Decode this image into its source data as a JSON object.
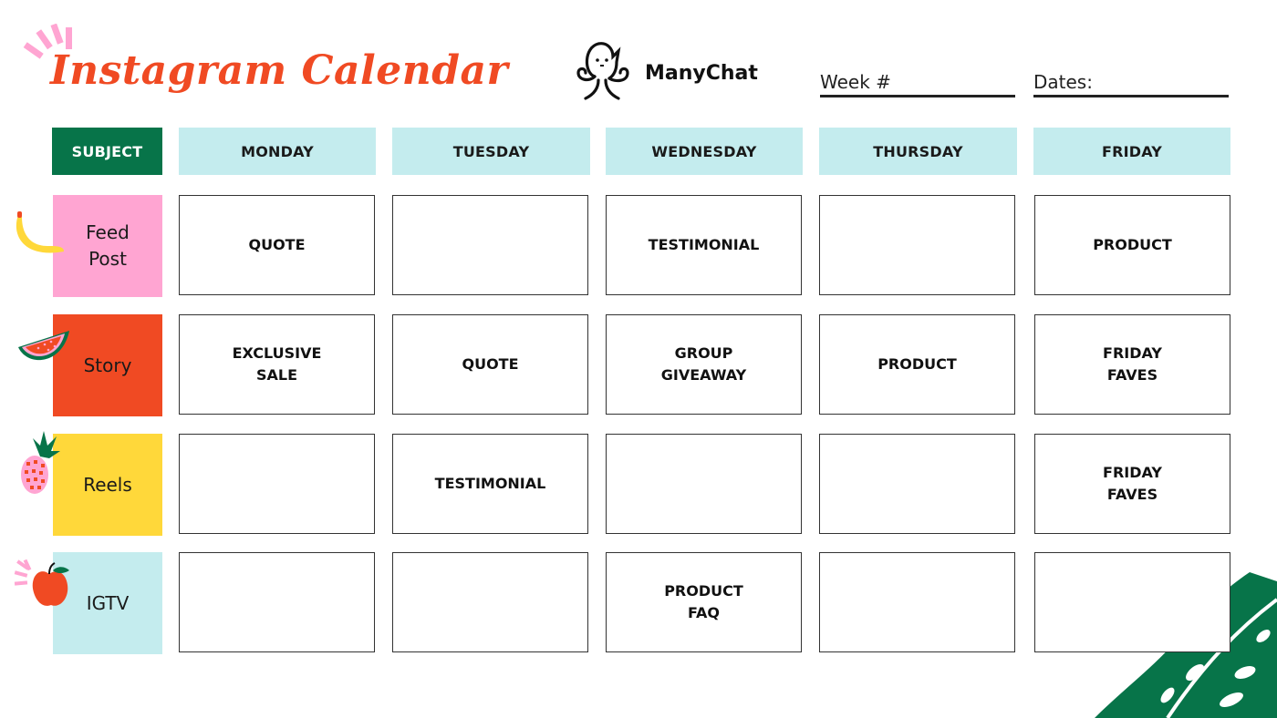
{
  "header": {
    "title": "Instagram Calendar",
    "brand": "ManyChat",
    "week_label": "Week #",
    "week_value": "",
    "dates_label": "Dates:",
    "dates_value": ""
  },
  "colors": {
    "title": "#f04a23",
    "subject_header": "#077449",
    "day_header": "#c4ecee",
    "feed_post": "#ffa5d2",
    "story": "#f04a23",
    "reels": "#ffd83a",
    "igtv": "#c4ecee",
    "leaf": "#077449"
  },
  "columns": {
    "subject": "SUBJECT",
    "days": [
      "MONDAY",
      "TUESDAY",
      "WEDNESDAY",
      "THURSDAY",
      "FRIDAY"
    ]
  },
  "rows": [
    {
      "label": "Feed\nPost",
      "icon": "banana-icon",
      "cells": [
        "QUOTE",
        "",
        "TESTIMONIAL",
        "",
        "PRODUCT"
      ]
    },
    {
      "label": "Story",
      "icon": "watermelon-icon",
      "cells": [
        "EXCLUSIVE\nSALE",
        "QUOTE",
        "GROUP\nGIVEAWAY",
        "PRODUCT",
        "FRIDAY\nFAVES"
      ]
    },
    {
      "label": "Reels",
      "icon": "pineapple-icon",
      "cells": [
        "",
        "TESTIMONIAL",
        "",
        "",
        "FRIDAY\nFAVES"
      ]
    },
    {
      "label": "IGTV",
      "icon": "apple-icon",
      "cells": [
        "",
        "",
        "PRODUCT\nFAQ",
        "",
        ""
      ]
    }
  ]
}
